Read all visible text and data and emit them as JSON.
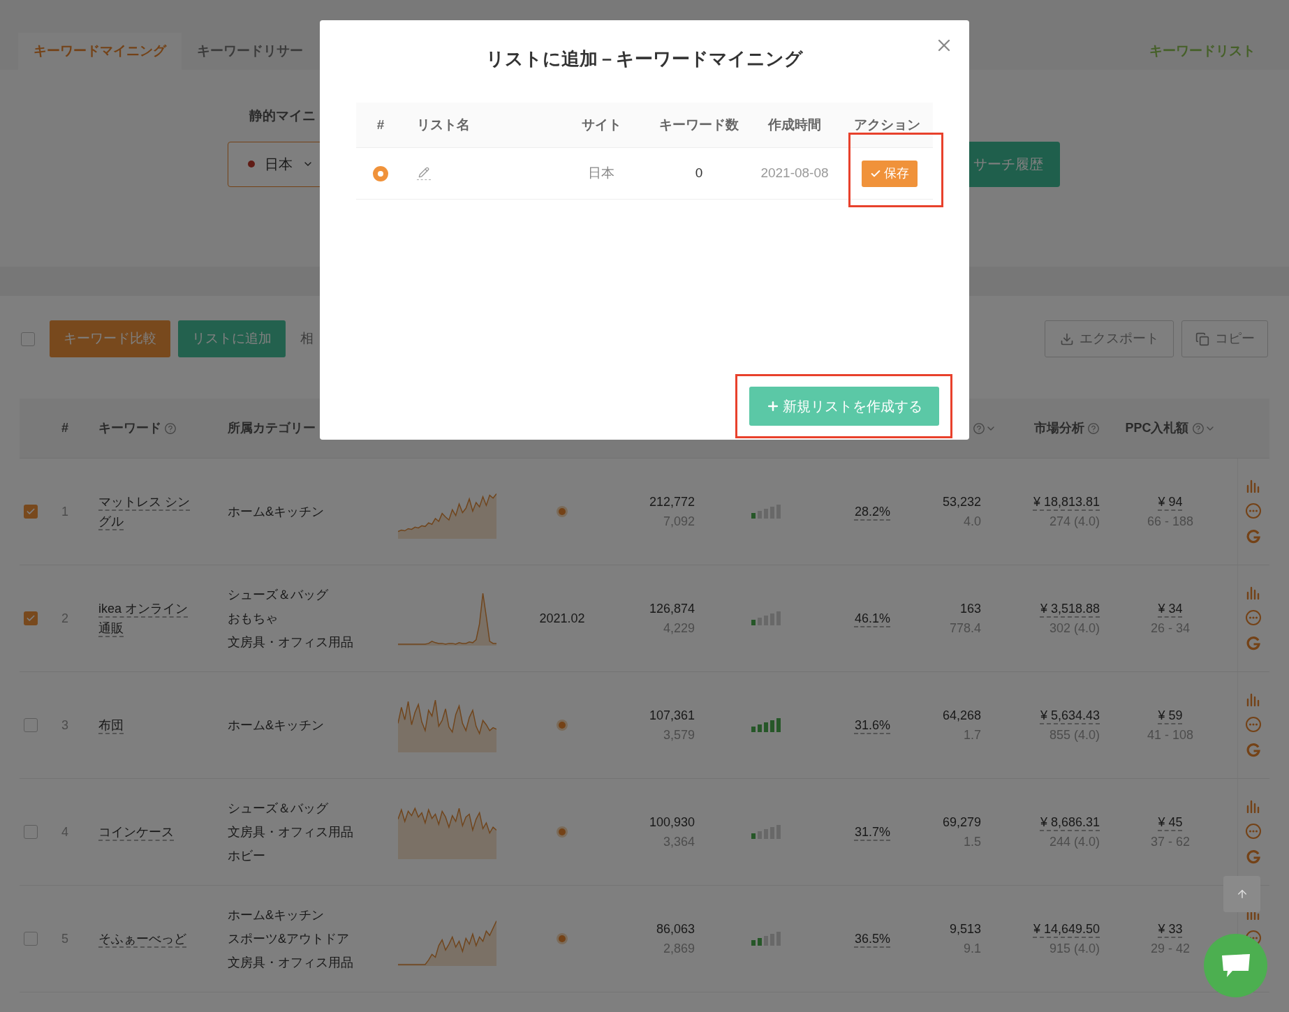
{
  "tabs": [
    {
      "label": "キーワードマイニング",
      "selected": true
    },
    {
      "label": "キーワードリサー",
      "selected": false
    }
  ],
  "tab_link": "キーワードリスト",
  "filter": {
    "label": "静的マイニ",
    "site_select": "日本",
    "history_button": "サーチ履歴"
  },
  "toolbar": {
    "select_all": {
      "checked": false
    },
    "compare_button": "キーワード比較",
    "add_button": "リストに追加",
    "cut_text": "相",
    "export_button": "エクスポート",
    "copy_button": "コピー"
  },
  "table": {
    "columns": [
      {
        "label": "#",
        "help": false,
        "sort": false
      },
      {
        "label": "キーワード",
        "help": true,
        "sort": false
      },
      {
        "label": "所属カテゴリー",
        "help": false,
        "sort": false
      },
      {
        "help": true,
        "sort": true
      },
      {
        "label": "市場分析",
        "help": true,
        "sort": false
      },
      {
        "label": "PPC入札額",
        "help": true,
        "sort": true
      }
    ],
    "rows": [
      {
        "checked": true,
        "num": "1",
        "keyword": "マットレス シングル",
        "categories": [
          "ホーム&キッチン"
        ],
        "kind": "dot",
        "volume": "212,772",
        "volume_sub": "7,092",
        "bars": [
          {
            "on": true
          },
          {
            "on": false
          },
          {
            "on": false
          },
          {
            "on": false
          },
          {
            "on": false
          }
        ],
        "percent": "28.2%",
        "count": "53,232",
        "count_sub": "4.0",
        "market": "¥ 18,813.81",
        "market_sub": "274 (4.0)",
        "ppc": "¥ 94",
        "ppc_range": "66 - 188"
      },
      {
        "checked": true,
        "num": "2",
        "keyword": "ikea オンライン通販",
        "categories": [
          "シューズ＆バッグ",
          "おもちゃ",
          "文房具・オフィス用品"
        ],
        "kind": "date",
        "date": "2021.02",
        "volume": "126,874",
        "volume_sub": "4,229",
        "bars": [
          {
            "on": true
          },
          {
            "on": false
          },
          {
            "on": false
          },
          {
            "on": false
          },
          {
            "on": false
          }
        ],
        "percent": "46.1%",
        "count": "163",
        "count_sub": "778.4",
        "market": "¥ 3,518.88",
        "market_sub": "302 (4.0)",
        "ppc": "¥ 34",
        "ppc_range": "26 - 34"
      },
      {
        "checked": false,
        "num": "3",
        "keyword": "布団",
        "categories": [
          "ホーム&キッチン"
        ],
        "kind": "dot",
        "volume": "107,361",
        "volume_sub": "3,579",
        "bars": [
          {
            "on": true
          },
          {
            "on": true
          },
          {
            "on": true
          },
          {
            "on": true
          },
          {
            "on": true
          }
        ],
        "percent": "31.6%",
        "count": "64,268",
        "count_sub": "1.7",
        "market": "¥ 5,634.43",
        "market_sub": "855 (4.0)",
        "ppc": "¥ 59",
        "ppc_range": "41 - 108"
      },
      {
        "checked": false,
        "num": "4",
        "keyword": "コインケース",
        "categories": [
          "シューズ＆バッグ",
          "文房具・オフィス用品",
          "ホビー"
        ],
        "kind": "dot",
        "volume": "100,930",
        "volume_sub": "3,364",
        "bars": [
          {
            "on": true
          },
          {
            "on": false
          },
          {
            "on": false
          },
          {
            "on": false
          },
          {
            "on": false
          }
        ],
        "percent": "31.7%",
        "count": "69,279",
        "count_sub": "1.5",
        "market": "¥ 8,686.31",
        "market_sub": "244 (4.0)",
        "ppc": "¥ 45",
        "ppc_range": "37 - 62"
      },
      {
        "checked": false,
        "num": "5",
        "keyword": "そふぁーべっど",
        "categories": [
          "ホーム&キッチン",
          "スポーツ&アウトドア",
          "文房具・オフィス用品"
        ],
        "kind": "dot",
        "volume": "86,063",
        "volume_sub": "2,869",
        "bars": [
          {
            "on": true
          },
          {
            "on": true
          },
          {
            "on": false
          },
          {
            "on": false
          },
          {
            "on": false
          }
        ],
        "percent": "36.5%",
        "count": "9,513",
        "count_sub": "9.1",
        "market": "¥ 14,649.50",
        "market_sub": "915 (4.0)",
        "ppc": "¥ 33",
        "ppc_range": "29 - 42"
      }
    ]
  },
  "modal": {
    "title": "リストに追加－キーワードマイニング",
    "columns": [
      "#",
      "リスト名",
      "サイト",
      "キーワード数",
      "作成時間",
      "アクション"
    ],
    "rows": [
      {
        "selected": true,
        "site": "日本",
        "count": "0",
        "created": "2021-08-08",
        "action": "保存"
      }
    ],
    "new_list_button": "新規リストを作成する"
  }
}
